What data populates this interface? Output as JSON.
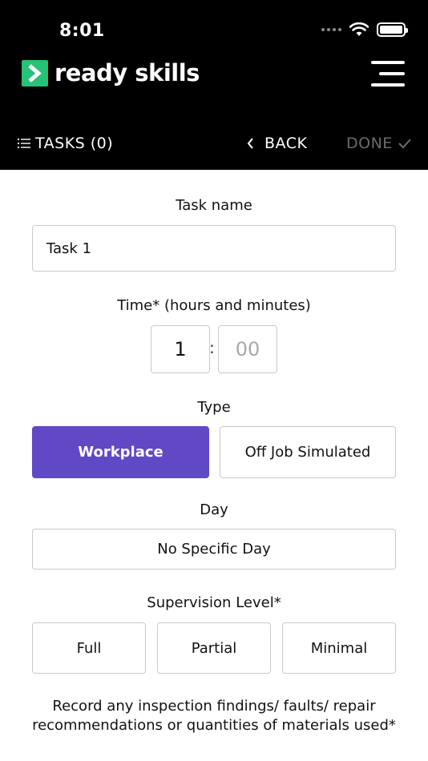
{
  "status_bar": {
    "time": "8:01"
  },
  "header": {
    "brand_name": "ready skills",
    "brand_color": "#27c276",
    "menu_icon": "hamburger-menu-icon"
  },
  "nav": {
    "tasks_label": "TASKS (0)",
    "back_label": "BACK",
    "done_label": "DONE"
  },
  "form": {
    "task_name": {
      "label": "Task name",
      "value": "Task 1"
    },
    "time": {
      "label": "Time* (hours and minutes)",
      "hours": "1",
      "minutes_placeholder": "00",
      "separator": ":"
    },
    "type": {
      "label": "Type",
      "options": [
        "Workplace",
        "Off Job Simulated"
      ],
      "selected": "Workplace"
    },
    "day": {
      "label": "Day",
      "value": "No Specific Day"
    },
    "supervision": {
      "label": "Supervision Level*",
      "options": [
        "Full",
        "Partial",
        "Minimal"
      ]
    },
    "record_label": "Record any inspection findings/ faults/ repair recommendations or quantities of materials used*"
  },
  "colors": {
    "accent": "#6148c4",
    "header_bg": "#000000"
  }
}
